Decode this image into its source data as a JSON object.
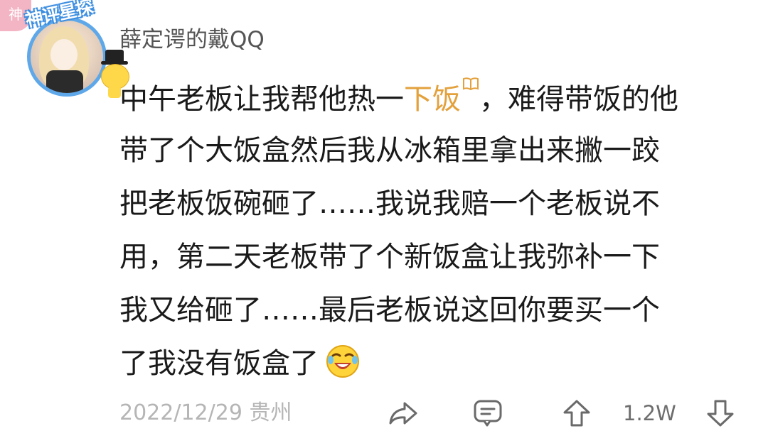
{
  "badge": {
    "label": "神"
  },
  "avatar": {
    "frame_title": "神评星探"
  },
  "user": {
    "name": "薛定谔的戴QQ"
  },
  "comment": {
    "line1_pre": "中午老板让我帮他热一",
    "line1_link": "下饭",
    "line1_post": "，难得带饭的他",
    "line2": "带了个大饭盒然后我从冰箱里拿出来撇一跤",
    "line3": "把老板饭碗砸了……我说我赔一个老板说不",
    "line4": "用，第二天老板带了个新饭盒让我弥补一下",
    "line5": "我又给砸了……最后老板说这回你要买一个",
    "line6": "了我没有饭盒了"
  },
  "footer": {
    "date_location": "2022/12/29 贵州",
    "vote_count": "1.2W"
  },
  "icons": {
    "share": "share-arrow-icon",
    "comment": "comment-bubble-icon",
    "upvote": "arrow-up-icon",
    "downvote": "arrow-down-icon",
    "book": "book-icon",
    "emoji": "laughing-crying-emoji"
  },
  "colors": {
    "badge_bg": "#f3b4c4",
    "link_highlight": "#e3a13c",
    "frame_blue": "#5ea8ea",
    "meta_gray": "#b5b5b5"
  }
}
